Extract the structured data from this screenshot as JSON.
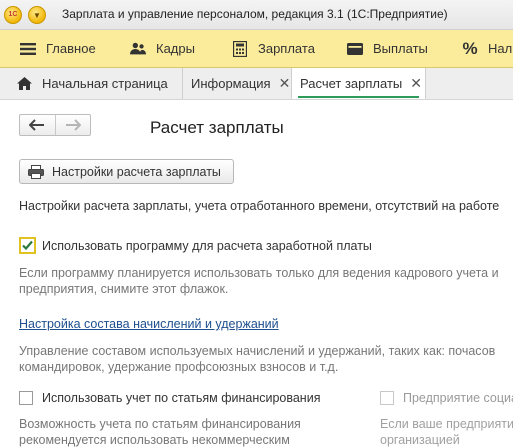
{
  "window": {
    "logo_text": "1С",
    "title": "Зарплата и управление персоналом, редакция 3.1  (1С:Предприятие)"
  },
  "sections": [
    {
      "label": "Главное",
      "icon": "menu-lines-icon"
    },
    {
      "label": "Кадры",
      "icon": "people-icon"
    },
    {
      "label": "Зарплата",
      "icon": "calculator-icon"
    },
    {
      "label": "Выплаты",
      "icon": "wallet-icon"
    },
    {
      "label": "Нал",
      "icon": "percent-icon"
    }
  ],
  "tabs": [
    {
      "label": "Начальная страница",
      "icon": "home-icon",
      "closable": false,
      "active": false
    },
    {
      "label": "Информация",
      "closable": true,
      "active": false
    },
    {
      "label": "Расчет зарплаты",
      "closable": true,
      "active": true
    }
  ],
  "form": {
    "title": "Расчет зарплаты",
    "settings_button": "Настройки расчета зарплаты",
    "settings_description": "Настройки расчета зарплаты, учета отработанного времени, отсутствий на работе",
    "use_program_label": "Использовать программу для расчета заработной платы",
    "use_program_checked": true,
    "use_program_hint_1": "Если программу планируется использовать только для ведения кадрового учета и",
    "use_program_hint_2": "предприятия, снимите этот флажок.",
    "accruals_link": "Настройка состава начислений и удержаний",
    "accruals_hint_1": "Управление составом используемых начислений и удержаний, таких как: почасов",
    "accruals_hint_2": "командировок, удержание профсоюзных взносов и т.д.",
    "financing_label": "Использовать учет по статьям финансирования",
    "financing_checked": false,
    "financing_hint_1": "Возможность учета по статьям финансирования",
    "financing_hint_2": "рекомендуется использовать некоммерческим",
    "social_label": "Предприятие социа",
    "social_checked": false,
    "social_hint_1": "Если ваше предприятие",
    "social_hint_2": "организацией"
  }
}
